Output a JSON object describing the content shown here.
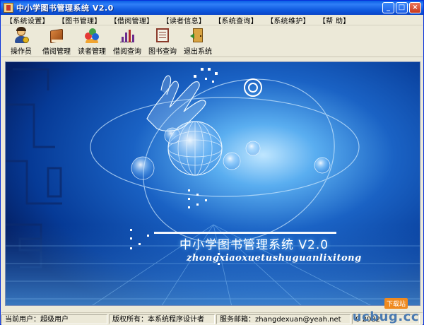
{
  "window": {
    "title": "中小学图书管理系统 V2.0",
    "buttons": {
      "minimize": "_",
      "maximize": "□",
      "close": "×"
    }
  },
  "menubar": {
    "items": [
      {
        "label": "【系统设置】"
      },
      {
        "label": "【图书管理】"
      },
      {
        "label": "【借阅管理】"
      },
      {
        "label": "【读者信息】"
      },
      {
        "label": "【系统查询】"
      },
      {
        "label": "【系统维护】"
      },
      {
        "label": "【帮  助】"
      }
    ]
  },
  "toolbar": {
    "items": [
      {
        "label": "操作员",
        "icon": "operator-icon"
      },
      {
        "label": "借阅管理",
        "icon": "book-borrow-icon"
      },
      {
        "label": "读者管理",
        "icon": "readers-icon"
      },
      {
        "label": "借阅查询",
        "icon": "chart-query-icon"
      },
      {
        "label": "图书查询",
        "icon": "book-query-icon"
      },
      {
        "label": "退出系统",
        "icon": "exit-door-icon"
      }
    ]
  },
  "banner": {
    "title": "中小学图书管理系统 V2.0",
    "subtitle": "zhongxiaoxuetushuguanlixitong"
  },
  "statusbar": {
    "user": "当前用户：超级用户",
    "copyright": "版权所有：本系统程序设计者",
    "email": "服务邮箱：zhangdexuan@yeah.net",
    "phone": "0  2082"
  },
  "watermark": {
    "text": "ucbug.cc",
    "badge": "下载站"
  },
  "colors": {
    "titlebar": "#0a5fe4",
    "chrome": "#ece9d8",
    "banner_bg": "#06338a"
  }
}
